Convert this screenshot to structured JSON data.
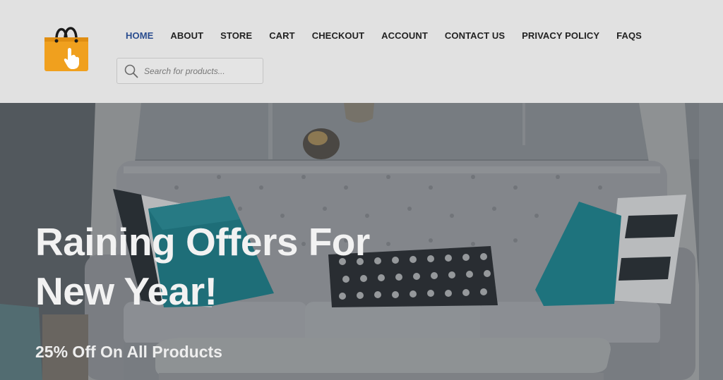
{
  "logo": {
    "icon": "shopping-bag-icon",
    "colors": {
      "bag": "#f0a01e",
      "handle": "#1a1a1a",
      "hand": "#ffffff"
    }
  },
  "nav": {
    "items": [
      {
        "label": "HOME",
        "active": true
      },
      {
        "label": "ABOUT"
      },
      {
        "label": "STORE"
      },
      {
        "label": "CART"
      },
      {
        "label": "CHECKOUT"
      },
      {
        "label": "ACCOUNT"
      },
      {
        "label": "CONTACT US"
      },
      {
        "label": "PRIVACY POLICY"
      },
      {
        "label": "FAQS"
      }
    ],
    "active_color": "#2a4d8f",
    "text_color": "#222222"
  },
  "search": {
    "placeholder": "Search for products...",
    "value": "",
    "icon": "search-icon"
  },
  "hero": {
    "title": "Raining Offers For New Year!",
    "subtitle": "25% Off On All Products",
    "background": "living-room-sofa-image"
  },
  "colors": {
    "header_bg": "#e1e1e1",
    "hero_text": "#f2f2f2",
    "accent_teal": "#1e8a96"
  }
}
